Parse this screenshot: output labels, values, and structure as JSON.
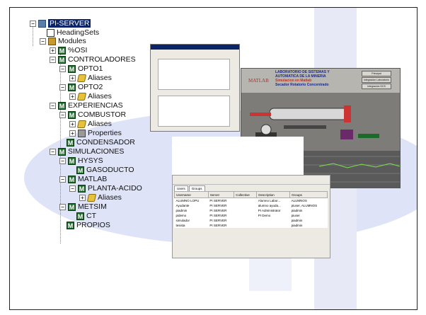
{
  "tree": {
    "server": "PI-SERVER",
    "heading_sets": "HeadingSets",
    "modules": "Modules",
    "xosi": "%OSI",
    "controladores": "CONTROLADORES",
    "opto1": "OPTO1",
    "opto1_aliases": "Aliases",
    "opto2": "OPTO2",
    "opto2_aliases": "Aliases",
    "experiencias": "EXPERIENCIAS",
    "combustor": "COMBUSTOR",
    "combustor_aliases": "Aliases",
    "combustor_properties": "Properties",
    "condensador": "CONDENSADOR",
    "simulaciones": "SIMULACIONES",
    "hysys": "HYSYS",
    "gasoducto": "GASODUCTO",
    "matlab": "MATLAB",
    "planta_acido": "PLANTA-ACIDO",
    "planta_aliases": "Aliases",
    "metsim": "METSIM",
    "ct": "CT",
    "propios": "PROPIOS"
  },
  "sim_window": {
    "matlab_logo": "MATLAB",
    "header_line1": "LABORATORIO DE SISTEMAS Y",
    "header_line2": "AUTOMATICA DE LA MINERIA",
    "header_line3": "Simulacion en Matlab",
    "header_line4": "Secador Rotatorio Concentrado",
    "btn1": "Principal",
    "btn2": "Integracion Laboratorio",
    "btn3": "Integracion DCS"
  },
  "users_window": {
    "tabs": [
      "Users",
      "Groups"
    ],
    "columns": [
      "Username",
      "Server",
      "Collective",
      "Description",
      "Groups"
    ],
    "rows": [
      [
        "ALUMNO LOPU",
        "PI SERVER",
        "",
        "Alumno Labor...",
        "ALUMNOS"
      ],
      [
        "Ayudante",
        "PI SERVER",
        "",
        "alumno ayuda...",
        "piuser, ALUMNOS"
      ],
      [
        "piadmin",
        "PI SERVER",
        "",
        "PI Administrator",
        "piadmin"
      ],
      [
        "pidemo",
        "PI SERVER",
        "",
        "PI Demo",
        "piuser"
      ],
      [
        "simulador",
        "PI SERVER",
        "",
        "",
        "piadmin"
      ],
      [
        "tesista",
        "PI SERVER",
        "",
        "",
        "piadmin"
      ]
    ]
  }
}
